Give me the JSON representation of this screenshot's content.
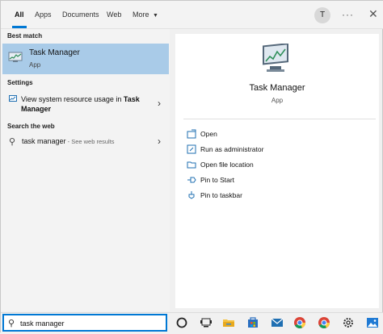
{
  "tabs": [
    {
      "label": "All",
      "active": true
    },
    {
      "label": "Apps"
    },
    {
      "label": "Documents"
    },
    {
      "label": "Web"
    },
    {
      "label": "More"
    }
  ],
  "user": {
    "initial": "T"
  },
  "left": {
    "best_match_title": "Best match",
    "best_match": {
      "name": "Task Manager",
      "type": "App"
    },
    "settings_title": "Settings",
    "setting_item_pre": "View system resource usage in ",
    "setting_item_bold": "Task Manager",
    "web_title": "Search the web",
    "web_item": {
      "query": "task manager",
      "suffix": " - See web results"
    }
  },
  "detail": {
    "title": "Task Manager",
    "subtitle": "App",
    "actions": [
      {
        "label": "Open",
        "icon": "open-icon"
      },
      {
        "label": "Run as administrator",
        "icon": "run-as-admin-icon"
      },
      {
        "label": "Open file location",
        "icon": "folder-icon"
      },
      {
        "label": "Pin to Start",
        "icon": "pin-icon"
      },
      {
        "label": "Pin to taskbar",
        "icon": "pin-icon"
      }
    ]
  },
  "taskbar": {
    "search_value": "task manager",
    "icons": [
      "cortana-icon",
      "task-view-icon",
      "file-explorer-icon",
      "store-icon",
      "mail-icon",
      "chrome-icon",
      "chrome-icon",
      "settings-icon",
      "photos-icon"
    ]
  },
  "colors": {
    "accent": "#0078d4",
    "selection": "#a9cbe8"
  }
}
